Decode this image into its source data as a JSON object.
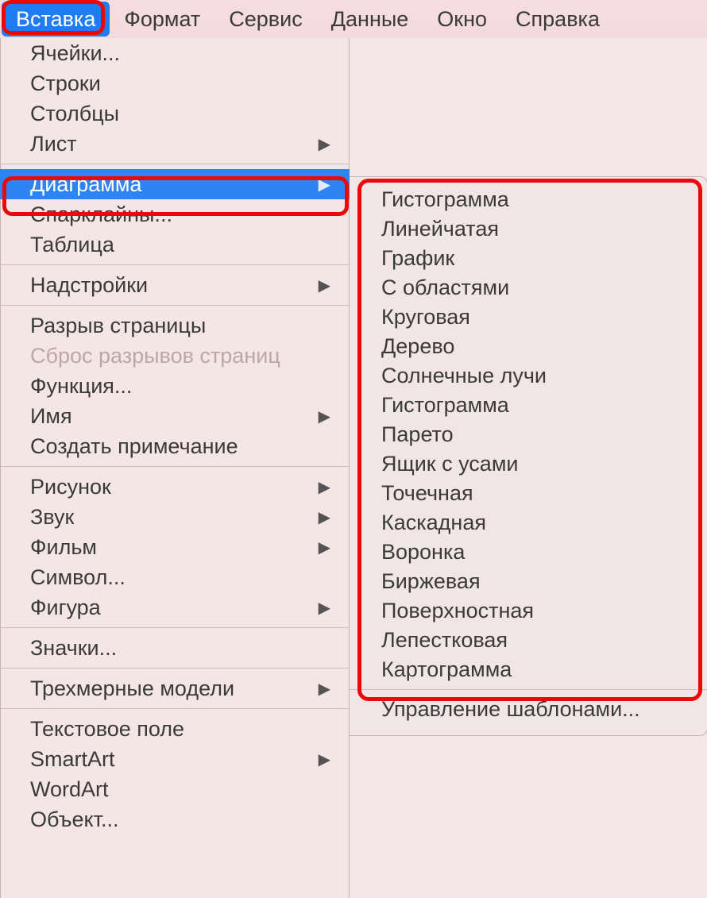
{
  "menubar": {
    "items": [
      {
        "label": "Вставка",
        "active": true
      },
      {
        "label": "Формат"
      },
      {
        "label": "Сервис"
      },
      {
        "label": "Данные"
      },
      {
        "label": "Окно"
      },
      {
        "label": "Справка"
      }
    ]
  },
  "dropdown": {
    "groups": [
      [
        {
          "label": "Ячейки..."
        },
        {
          "label": "Строки"
        },
        {
          "label": "Столбцы"
        },
        {
          "label": "Лист",
          "submenu": true
        }
      ],
      [
        {
          "label": "Диаграмма",
          "submenu": true,
          "selected": true
        },
        {
          "label": "Спарклайны..."
        },
        {
          "label": "Таблица"
        }
      ],
      [
        {
          "label": "Надстройки",
          "submenu": true
        }
      ],
      [
        {
          "label": "Разрыв страницы"
        },
        {
          "label": "Сброс разрывов страниц",
          "disabled": true
        },
        {
          "label": "Функция..."
        },
        {
          "label": "Имя",
          "submenu": true
        },
        {
          "label": "Создать примечание"
        }
      ],
      [
        {
          "label": "Рисунок",
          "submenu": true
        },
        {
          "label": "Звук",
          "submenu": true
        },
        {
          "label": "Фильм",
          "submenu": true
        },
        {
          "label": "Символ..."
        },
        {
          "label": "Фигура",
          "submenu": true
        }
      ],
      [
        {
          "label": "Значки..."
        }
      ],
      [
        {
          "label": "Трехмерные модели",
          "submenu": true
        }
      ],
      [
        {
          "label": "Текстовое поле"
        },
        {
          "label": "SmartArt",
          "submenu": true
        },
        {
          "label": "WordArt"
        },
        {
          "label": "Объект..."
        }
      ]
    ]
  },
  "submenu": {
    "chart_types": [
      {
        "label": "Гистограмма"
      },
      {
        "label": "Линейчатая"
      },
      {
        "label": "График"
      },
      {
        "label": "С областями"
      },
      {
        "label": "Круговая"
      },
      {
        "label": "Дерево"
      },
      {
        "label": "Солнечные лучи"
      },
      {
        "label": "Гистограмма"
      },
      {
        "label": "Парето"
      },
      {
        "label": "Ящик с усами"
      },
      {
        "label": "Точечная"
      },
      {
        "label": "Каскадная"
      },
      {
        "label": "Воронка"
      },
      {
        "label": "Биржевая"
      },
      {
        "label": "Поверхностная"
      },
      {
        "label": "Лепестковая"
      },
      {
        "label": "Картограмма"
      }
    ],
    "manage_templates": "Управление шаблонами..."
  },
  "highlight_color": "#ea0809",
  "selection_color": "#2f84f4"
}
